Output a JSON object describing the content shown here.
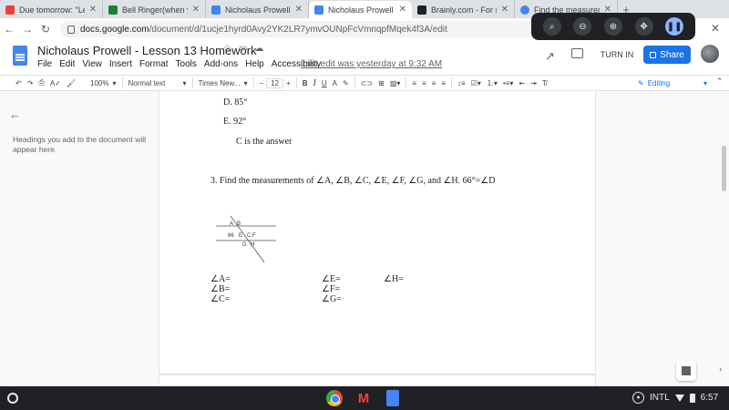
{
  "browser": {
    "tabs": [
      {
        "label": "Due tomorrow: \"Lesson",
        "color": "#ea4335",
        "active": false
      },
      {
        "label": "Bell Ringer(when you w",
        "color": "#188038",
        "active": false
      },
      {
        "label": "Nicholaus Prowell - Bell",
        "color": "#4285f4",
        "active": false
      },
      {
        "label": "Nicholaus Prowell - Les",
        "color": "#4285f4",
        "active": true
      },
      {
        "label": "Brainly.com - For stude",
        "color": "#202124",
        "active": false
      },
      {
        "label": "Find the measuremen",
        "color": "#4285f4",
        "active": false
      }
    ],
    "new_tab": "+",
    "url_host": "docs.google.com",
    "url_path": "/document/d/1ucje1hyrd0Avy2YK2LR7ymvOUNpFcVmnqpfMqek4f3A/edit"
  },
  "docs": {
    "title": "Nicholaus Prowell - Lesson 13 Homework",
    "menu": [
      "File",
      "Edit",
      "View",
      "Insert",
      "Format",
      "Tools",
      "Add-ons",
      "Help",
      "Accessibility"
    ],
    "last_edit": "Last edit was yesterday at 9:32 AM",
    "turn_in": "TURN IN",
    "share": "Share"
  },
  "toolbar": {
    "zoom": "100%",
    "style": "Normal text",
    "font": "Times New...",
    "size": "12",
    "minus": "−",
    "plus": "+",
    "bold": "B",
    "italic": "I",
    "underline": "U",
    "text_color": "A",
    "mode": "Editing"
  },
  "outline": {
    "hint": "Headings you add to the document will appear here."
  },
  "document": {
    "option_d": "D.  85°",
    "option_e": "E.  92°",
    "answer": "C is the answer",
    "question": "3. Find the measurements of ∠A, ∠B, ∠C, ∠E, ∠F, ∠G, and ∠H. 66°=∠D",
    "figure": {
      "a": "A",
      "b": "B",
      "d": "66",
      "e": "E",
      "c": "C",
      "f": "F",
      "g": "G",
      "h": "H"
    },
    "answers": {
      "a": "∠A=",
      "b": "∠B=",
      "c": "∠C=",
      "e": "∠E=",
      "f": "∠F=",
      "g": "∠G=",
      "h": "∠H="
    }
  },
  "shelf": {
    "locale": "INTL",
    "time": "6:57"
  }
}
